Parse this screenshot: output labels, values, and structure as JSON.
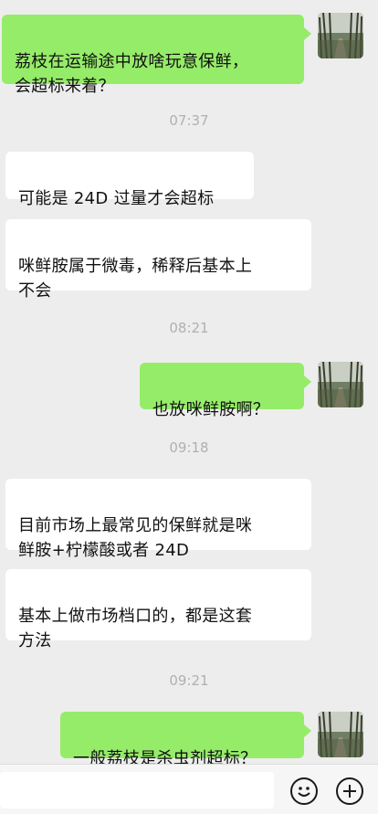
{
  "messages": [
    {
      "side": "right",
      "text": "荔枝在运输途中放啥玩意保鲜，\n会超标来着？"
    },
    {
      "type": "time",
      "text": "07:37"
    },
    {
      "side": "left",
      "text": "可能是 24D 过量才会超标"
    },
    {
      "side": "left",
      "text": "咪鲜胺属于微毒，稀释后基本上\n不会"
    },
    {
      "type": "time",
      "text": "08:21"
    },
    {
      "side": "right",
      "text": "也放咪鲜胺啊？"
    },
    {
      "type": "time",
      "text": "09:18"
    },
    {
      "side": "left",
      "text": "目前市场上最常见的保鲜就是咪\n鲜胺+柠檬酸或者 24D"
    },
    {
      "side": "left",
      "text": "基本上做市场档口的，都是这套\n方法"
    },
    {
      "type": "time",
      "text": "09:21"
    },
    {
      "side": "right",
      "text": "一般荔枝是杀虫剂超标？"
    }
  ],
  "colors": {
    "background": "#ededed",
    "sent_bubble": "#95ec69",
    "received_bubble": "#ffffff",
    "timestamp": "#b0b0b0"
  },
  "icons": {
    "emoji": "emoji-face-icon",
    "add": "plus-circle-icon",
    "avatar": "forest-road-avatar"
  }
}
